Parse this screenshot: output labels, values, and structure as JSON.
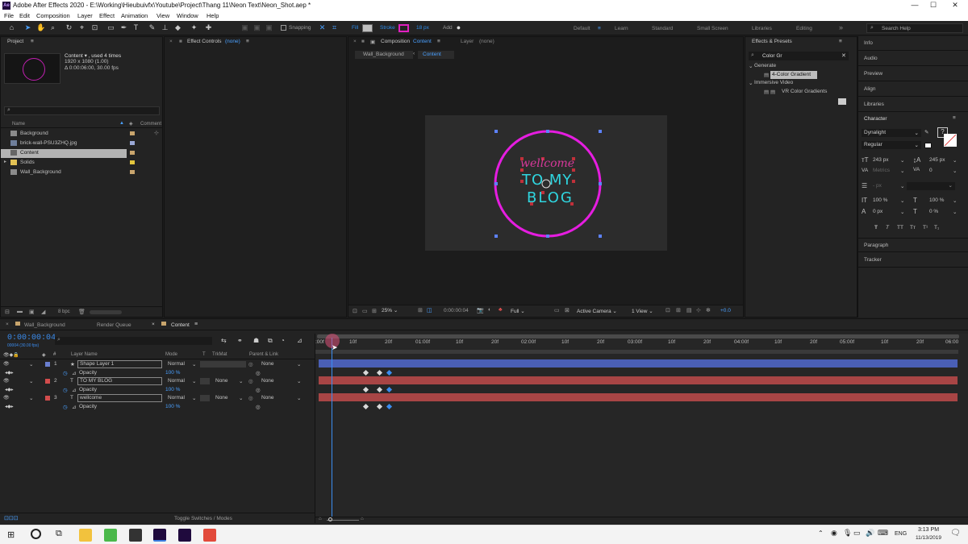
{
  "window": {
    "title": "Adobe After Effects 2020 - E:\\Working\\Hieubuivfx\\Youtube\\Project\\Thang 11\\Neon Text\\Neon_Shot.aep *",
    "app_badge": "Ae",
    "min": "—",
    "max": "☐",
    "close": "✕"
  },
  "menu": [
    "File",
    "Edit",
    "Composition",
    "Layer",
    "Effect",
    "Animation",
    "View",
    "Window",
    "Help"
  ],
  "toolbar": {
    "snapping": "Snapping",
    "fill": "Fill",
    "stroke": "Stroke",
    "stroke_px": "18 px",
    "add": "Add",
    "workspaces": [
      "Default",
      "Learn",
      "Standard",
      "Small Screen",
      "Libraries",
      "Editing"
    ],
    "search_help": "Search Help",
    "more": "»"
  },
  "project": {
    "tab": "Project",
    "comp_name": "Content ▾ , used 4 times",
    "comp_size": "1920 x 1080 (1.00)",
    "comp_duration": "Δ 0:00:06:00, 30.00 fps",
    "col_name": "Name",
    "col_comment": "Comment",
    "bpc": "8 bpc",
    "items": [
      {
        "name": "Background",
        "color": "#c9a56d"
      },
      {
        "name": "brick-wall-PSU3ZHQ.jpg",
        "color": "#9aa8d6"
      },
      {
        "name": "Content",
        "color": "#c9a56d"
      },
      {
        "name": "Solids",
        "color": "#e3c53d"
      },
      {
        "name": "Wall_Background",
        "color": "#c9a56d"
      }
    ]
  },
  "effect_controls": {
    "tab": "Effect Controls",
    "target": "(none)"
  },
  "composition": {
    "tab": "Composition",
    "comp": "Content",
    "layer_tab": "Layer",
    "layer_target": "(none)",
    "crumb1": "Wall_Background",
    "crumb2": "Content",
    "art": {
      "line1": "wellcome",
      "line2": "TO MY",
      "line3": "BLOG"
    },
    "footer": {
      "zoom": "25%",
      "time": "0:00:00:04",
      "quality": "Full",
      "camera": "Active Camera",
      "views": "1 View",
      "exposure": "+0.0"
    }
  },
  "effects_presets": {
    "tab": "Effects & Presets",
    "search": "Color Gr",
    "groups": [
      {
        "name": "Generate",
        "items": [
          "4-Color Gradient"
        ]
      },
      {
        "name": "Immersive Video",
        "items": [
          "VR Color Gradients"
        ]
      }
    ]
  },
  "right_tabs": [
    "Info",
    "Audio",
    "Preview",
    "Align",
    "Libraries"
  ],
  "character": {
    "tab": "Character",
    "font": "Dynalight",
    "style": "Regular",
    "size": "243 px",
    "leading": "245 px",
    "kerning": "Metrics",
    "tracking": "0",
    "stroke_w": "- px",
    "vscale": "100 %",
    "hscale": "100 %",
    "baseline": "0 px",
    "tsume": "0 %",
    "type_buttons": [
      "T",
      "T",
      "TT",
      "Tт",
      "T¹",
      "T₁"
    ],
    "paragraph": "Paragraph",
    "tracker": "Tracker"
  },
  "timeline": {
    "tabs": [
      "Wall_Background",
      "Render Queue",
      "Content"
    ],
    "timecode": "0:00:00:04",
    "frame_info": "00004 (30.00 fps)",
    "headers": {
      "layer_name": "Layer Name",
      "mode": "Mode",
      "t": "T",
      "trkmat": "TrkMat",
      "parent": "Parent & Link"
    },
    "layers": [
      {
        "index": "1",
        "type": "★",
        "name": "Shape Layer 1",
        "mode": "Normal",
        "trkmat": "",
        "parent": "None",
        "label": "#6a7fd0",
        "prop": "Opacity",
        "val": "100 %",
        "bar": "#4a5fb5"
      },
      {
        "index": "2",
        "type": "T",
        "name": "TO MY  BLOG",
        "mode": "Normal",
        "trkmat": "None",
        "parent": "None",
        "label": "#d24c4c",
        "prop": "Opacity",
        "val": "100 %",
        "bar": "#a84545"
      },
      {
        "index": "3",
        "type": "T",
        "name": "wellcome",
        "mode": "Normal",
        "trkmat": "None",
        "parent": "None",
        "label": "#d24c4c",
        "prop": "Opacity",
        "val": "100 %",
        "bar": "#a84545"
      }
    ],
    "ruler": [
      ":00f",
      "10f",
      "20f",
      "01:00f",
      "10f",
      "20f",
      "02:00f",
      "10f",
      "20f",
      "03:00f",
      "10f",
      "20f",
      "04:00f",
      "10f",
      "20f",
      "05:00f",
      "10f",
      "20f",
      "06:00"
    ],
    "toggle": "Toggle Switches / Modes"
  },
  "taskbar": {
    "lang": "ENG",
    "time": "3:13 PM",
    "date": "11/13/2019"
  }
}
